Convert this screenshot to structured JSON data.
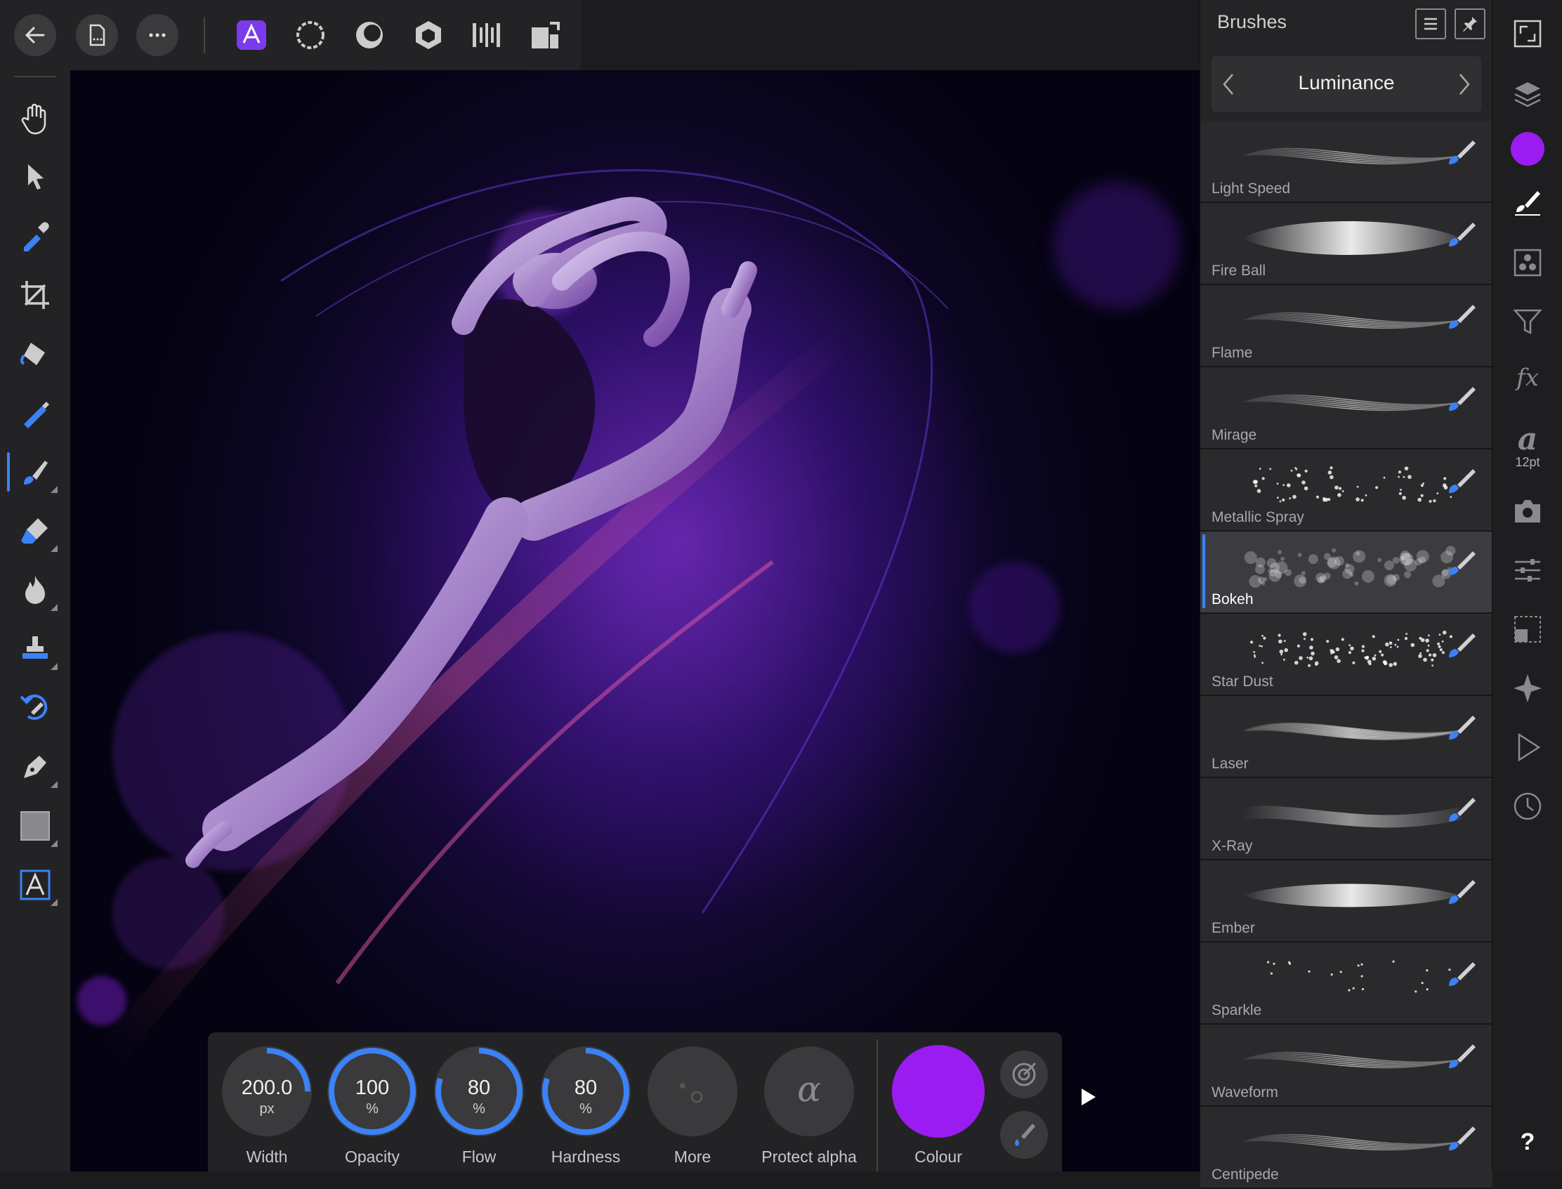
{
  "colors": {
    "accent": "#3b82f6",
    "brush_colour": "#9b1cf0",
    "panel_bg": "#242426"
  },
  "top_bar": {
    "back_icon": "back-arrow-icon",
    "document_icon": "document-icon",
    "more_icon": "more-icon",
    "personas": [
      "photo-persona-icon",
      "liquify-persona-icon",
      "develop-persona-icon",
      "tone-mapping-persona-icon",
      "export-persona-icon",
      "layout-persona-icon"
    ]
  },
  "tools": [
    "hand-tool-icon",
    "move-tool-icon",
    "colour-picker-icon",
    "crop-tool-icon",
    "flood-fill-icon",
    "selection-brush-icon",
    "paint-brush-icon",
    "erase-brush-icon",
    "burn-brush-icon",
    "clone-brush-icon",
    "undo-brush-icon",
    "pen-tool-icon",
    "rectangle-tool-icon",
    "text-tool-icon"
  ],
  "brushes_panel": {
    "title": "Brushes",
    "category": "Luminance",
    "items": [
      {
        "name": "Light Speed"
      },
      {
        "name": "Fire Ball"
      },
      {
        "name": "Flame"
      },
      {
        "name": "Mirage"
      },
      {
        "name": "Metallic Spray"
      },
      {
        "name": "Bokeh",
        "selected": true
      },
      {
        "name": "Star Dust"
      },
      {
        "name": "Laser"
      },
      {
        "name": "X-Ray"
      },
      {
        "name": "Ember"
      },
      {
        "name": "Sparkle"
      },
      {
        "name": "Waveform"
      },
      {
        "name": "Centipede"
      }
    ]
  },
  "studio": {
    "text_size": "12pt",
    "help": "?"
  },
  "context_toolbar": {
    "width": {
      "value": "200.0",
      "unit": "px",
      "label": "Width",
      "fraction": 0.25
    },
    "opacity": {
      "value": "100",
      "unit": "%",
      "label": "Opacity",
      "fraction": 1.0
    },
    "flow": {
      "value": "80",
      "unit": "%",
      "label": "Flow",
      "fraction": 0.8
    },
    "hardness": {
      "value": "80",
      "unit": "%",
      "label": "Hardness",
      "fraction": 0.8
    },
    "more": {
      "label": "More"
    },
    "protect_alpha": {
      "label": "Protect alpha",
      "symbol": "α"
    },
    "colour": {
      "label": "Colour"
    }
  }
}
